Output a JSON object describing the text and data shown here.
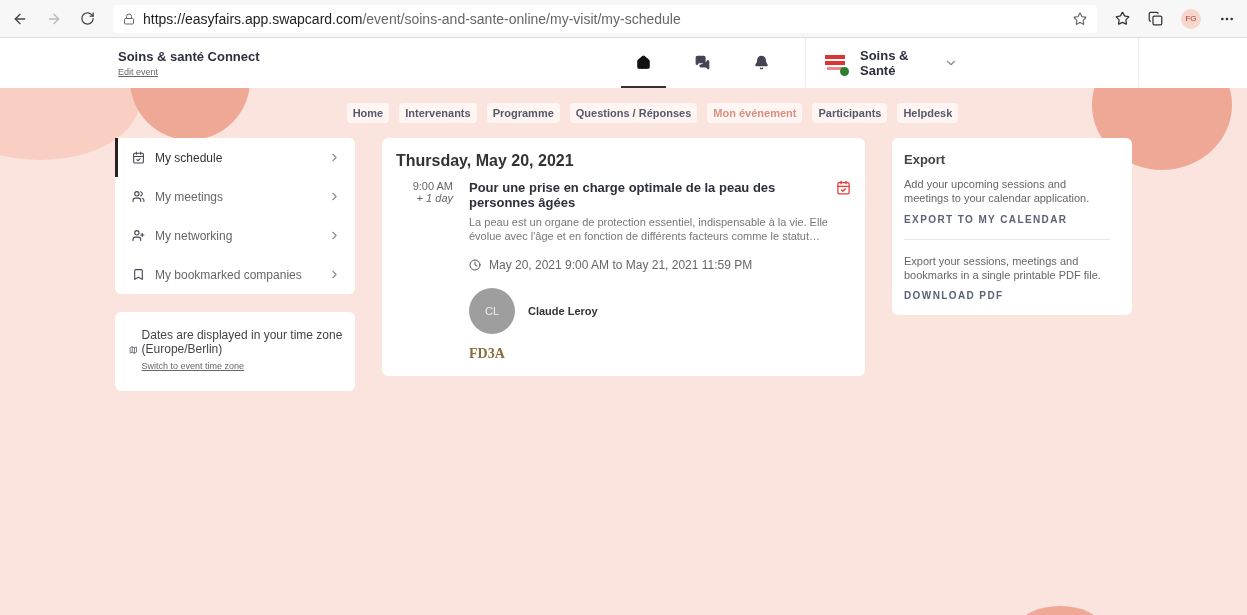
{
  "browser": {
    "url_host": "https://easyfairs.app.swapcard.com",
    "url_path": "/event/soins-and-sante-online/my-visit/my-schedule",
    "profile": "FG"
  },
  "header": {
    "title": "Soins & santé Connect",
    "edit_link": "Edit event",
    "icons": [
      {
        "kind": "home",
        "selected": true
      },
      {
        "kind": "chat",
        "selected": false
      },
      {
        "kind": "bell",
        "selected": false
      }
    ],
    "account": {
      "name": "Soins & Santé",
      "online": true
    }
  },
  "nav": [
    {
      "label": "Home",
      "selected": false
    },
    {
      "label": "Intervenants",
      "selected": false
    },
    {
      "label": "Programme",
      "selected": false
    },
    {
      "label": "Questions / Réponses",
      "selected": false
    },
    {
      "label": "Mon événement",
      "selected": true
    },
    {
      "label": "Participants",
      "selected": false
    },
    {
      "label": "Helpdesk",
      "selected": false
    }
  ],
  "sidebar": {
    "items": [
      {
        "label": "My schedule",
        "kind": "schedule",
        "selected": true
      },
      {
        "label": "My meetings",
        "kind": "meetings",
        "selected": false
      },
      {
        "label": "My networking",
        "kind": "networking",
        "selected": false
      },
      {
        "label": "My bookmarked companies",
        "kind": "bookmarks",
        "selected": false
      }
    ],
    "timezone": {
      "text": "Dates are displayed in your time zone (Europe/Berlin)",
      "link": "Switch to event time zone"
    }
  },
  "schedule": {
    "date": "Thursday, May 20, 2021",
    "sessions": [
      {
        "time": "9:00 AM",
        "offset": "+ 1 day",
        "title": "Pour une prise en charge optimale de la peau des personnes âgées",
        "description": "La peau est un organe de protection essentiel, indispensable à la vie. Elle évolue avec l'âge et en fonction de différents facteurs comme le statut…",
        "range": "May 20, 2021 9:00 AM to May 21, 2021 11:59 PM",
        "speaker": {
          "initials": "CL",
          "name": "Claude Leroy"
        },
        "sponsor_logo": "FD3A"
      }
    ]
  },
  "export": {
    "title": "Export",
    "sections": [
      {
        "text": "Add your upcoming sessions and meetings to your calendar application.",
        "action": "EXPORT TO MY CALENDAR"
      },
      {
        "text": "Export your sessions, meetings and bookmarks in a single printable PDF file.",
        "action": "DOWNLOAD PDF"
      }
    ]
  }
}
